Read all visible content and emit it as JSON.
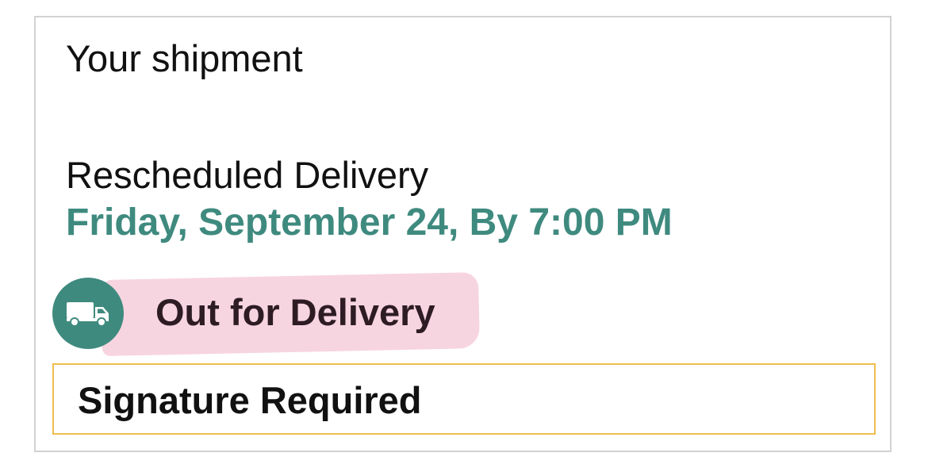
{
  "shipment": {
    "title": "Your shipment",
    "delivery_label": "Rescheduled Delivery",
    "delivery_date": "Friday, September 24, By 7:00 PM",
    "status_icon": "truck-icon",
    "status": "Out for Delivery",
    "notice": "Signature Required"
  },
  "colors": {
    "accent": "#3f8a7f",
    "highlight": "#f7d3de",
    "notice_border": "#efbd4f",
    "card_border": "#d2d2d2"
  }
}
